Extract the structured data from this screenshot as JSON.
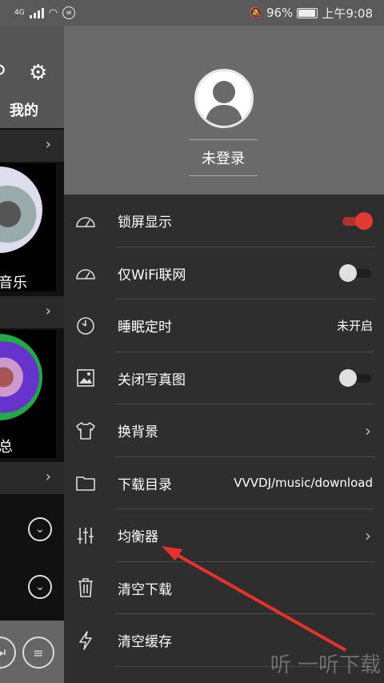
{
  "status_bar": {
    "network": "4G",
    "battery": "96%",
    "time": "上午9:08"
  },
  "background_app": {
    "tab_mine": "我的",
    "card1_label": "音乐",
    "card2_label": "总"
  },
  "drawer": {
    "login_label": "未登录",
    "menu": [
      {
        "label": "锁屏显示",
        "icon": "speedometer-icon",
        "control": "toggle-on"
      },
      {
        "label": "仅WiFi联网",
        "icon": "speedometer-icon",
        "control": "toggle-off"
      },
      {
        "label": "睡眠定时",
        "icon": "timer-icon",
        "value": "未开启"
      },
      {
        "label": "关闭写真图",
        "icon": "image-icon",
        "control": "toggle-off"
      },
      {
        "label": "换背景",
        "icon": "tshirt-icon",
        "control": "chevron"
      },
      {
        "label": "下载目录",
        "icon": "folder-icon",
        "value": "VVVDJ/music/download"
      },
      {
        "label": "均衡器",
        "icon": "equalizer-icon",
        "control": "chevron"
      },
      {
        "label": "清空下载",
        "icon": "trash-icon"
      },
      {
        "label": "清空缓存",
        "icon": "lightning-icon"
      }
    ]
  },
  "watermark": "听 一听下载",
  "colors": {
    "accent_red": "#e33b33",
    "drawer_bg": "#2e2e2e",
    "header_bg": "#6a6a6a"
  }
}
